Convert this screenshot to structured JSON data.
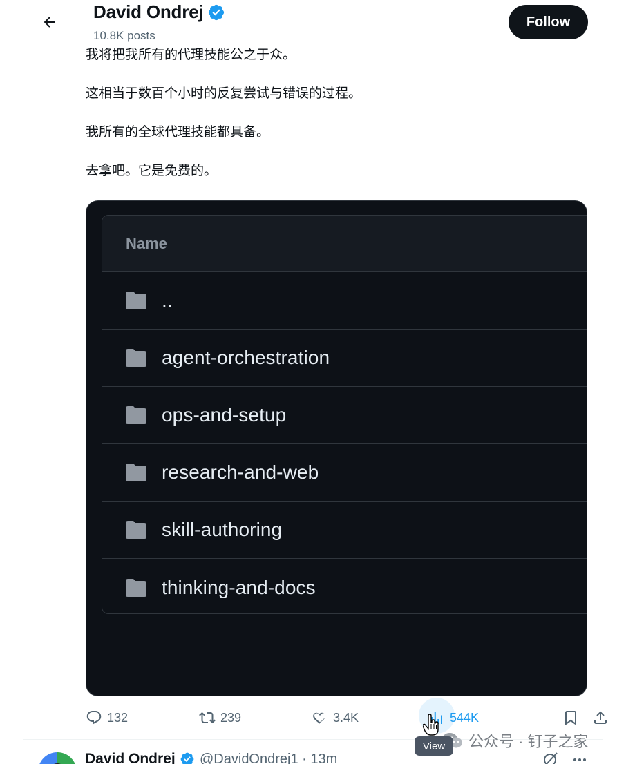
{
  "header": {
    "name": "David Ondrej",
    "posts": "10.8K posts",
    "follow_label": "Follow"
  },
  "tweet": {
    "lines": [
      "我将把我所有的代理技能公之于众。",
      "这相当于数百个小时的反复尝试与错误的过程。",
      "我所有的全球代理技能都具备。",
      "去拿吧。它是免费的。"
    ]
  },
  "media": {
    "column_header": "Name",
    "rows": [
      "..",
      "agent-orchestration",
      "ops-and-setup",
      "research-and-web",
      "skill-authoring",
      "thinking-and-docs"
    ]
  },
  "actions": {
    "replies": "132",
    "reposts": "239",
    "likes": "3.4K",
    "views": "544K",
    "views_tooltip": "View"
  },
  "watermark": "公众号 · 钉子之家",
  "next_tweet": {
    "name": "David Ondrej",
    "handle_time": "@DavidOndrej1 · 13m"
  },
  "colors": {
    "accent": "#1d9bf0",
    "text": "#0f1419",
    "muted": "#536471",
    "media_bg": "#0d1117",
    "verified": "#1d9bf0"
  },
  "icons": {
    "back": "arrow-left-icon",
    "verified": "verified-badge-icon",
    "folder": "folder-icon",
    "reply": "reply-icon",
    "repost": "repost-icon",
    "like": "heart-icon",
    "views": "analytics-icon",
    "bookmark": "bookmark-icon",
    "share": "share-icon"
  }
}
